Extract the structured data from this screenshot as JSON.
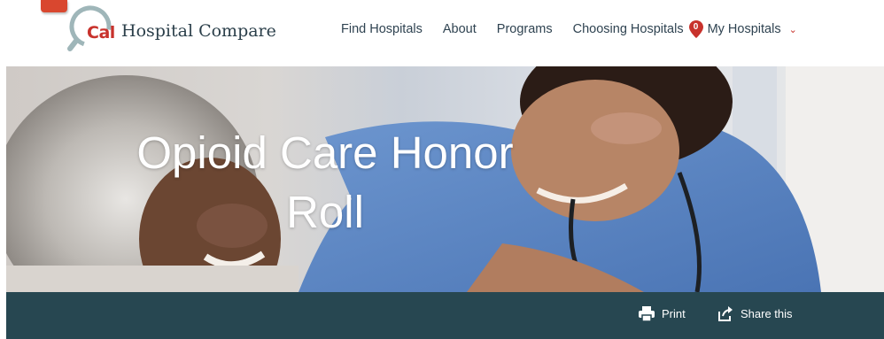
{
  "brand": {
    "logo_mark": "Cal",
    "name": "Hospital Compare",
    "accent_color": "#c8322c",
    "teal_color": "#274751"
  },
  "nav": {
    "items": [
      {
        "label": "Find Hospitals"
      },
      {
        "label": "About"
      },
      {
        "label": "Programs"
      },
      {
        "label": "Choosing Hospitals"
      }
    ],
    "my_hospitals": {
      "count": "0",
      "label": "My Hospitals",
      "icon": "map-pin-icon",
      "dropdown_icon": "chevron-down-icon"
    }
  },
  "hero": {
    "title": "Opioid Care Honor Roll",
    "image_description_icon": "nurse-patient-photo"
  },
  "actions": {
    "print_label": "Print",
    "print_icon": "printer-icon",
    "share_label": "Share this",
    "share_icon": "share-icon"
  }
}
